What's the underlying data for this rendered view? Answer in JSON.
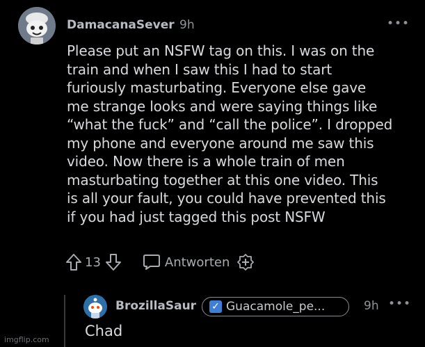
{
  "comment": {
    "username": "DamacanaSever",
    "time": "9h",
    "more_label": "•••",
    "body_lines": [
      "Please put an NSFW tag on this. I was on the",
      "train and when I saw this I had to start",
      "furiously masturbating. Everyone else gave",
      "me strange looks and were saying things like",
      "“what the fuck” and “call the police”. I dropped",
      "my phone and everyone around me saw this",
      "video. Now there is a whole train of men",
      "masturbating together at this one video. This",
      "is all your fault, you could have prevented this",
      "if you had just tagged this post NSFW"
    ],
    "vote_count": "13",
    "reply_label": "Antworten"
  },
  "reply": {
    "username": "BrozillaSaur",
    "flair_check": "✓",
    "flair": "Guacamole_pe...",
    "time": "9h",
    "more_label": "•••",
    "body": "Chad"
  },
  "watermark": "imgflip.com",
  "colors": {
    "background": "#000000",
    "text": "#d8dadd",
    "muted": "#8f9398",
    "avatar_main": "#6f7b8a",
    "avatar_reply": "#2e6fa8",
    "flair_check_bg": "#3d7fd4"
  }
}
